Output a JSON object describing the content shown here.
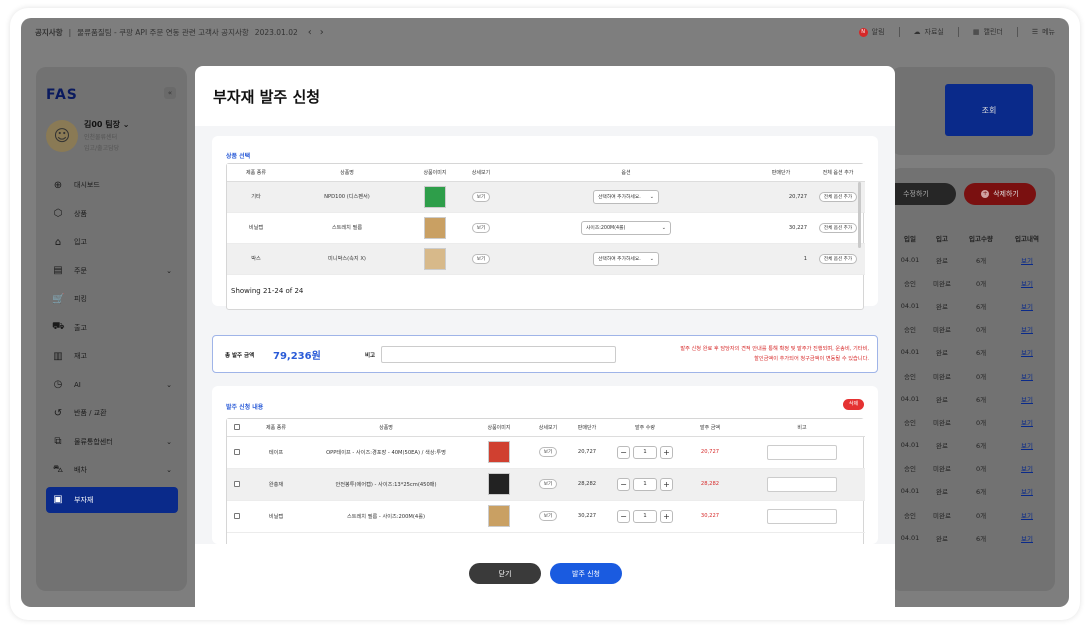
{
  "topbar": {
    "notice_tag": "공지사항",
    "notice_text": "물류품질팀 - 쿠팡 API 주문 연동 관련 고객사 공지사항",
    "notice_date": "2023.01.02",
    "prev_icon": "‹",
    "next_icon": "›",
    "notif_badge": "N",
    "notif_label": "알림",
    "data_label": "자료실",
    "calendar_label": "캘린더",
    "menu_label": "메뉴"
  },
  "sidebar": {
    "logo": "FAS",
    "collapse_icon": "«",
    "user_name": "김00 팀장",
    "user_team": "인천물류센터",
    "user_role": "입고/출고담당",
    "items": [
      {
        "label": "대시보드",
        "icon": "⊕"
      },
      {
        "label": "상품",
        "icon": "⬡"
      },
      {
        "label": "입고",
        "icon": "⌂"
      },
      {
        "label": "주문",
        "icon": "▤",
        "chevron": "⌄"
      },
      {
        "label": "피킹",
        "icon": "🛒"
      },
      {
        "label": "출고",
        "icon": "⛟"
      },
      {
        "label": "재고",
        "icon": "▥"
      },
      {
        "label": "AI",
        "icon": "◷",
        "chevron": "⌄"
      },
      {
        "label": "반품 / 교환",
        "icon": "↺"
      },
      {
        "label": "물류통합센터",
        "icon": "⧉",
        "chevron": "⌄"
      },
      {
        "label": "배차",
        "icon": "⛍",
        "chevron": "⌄"
      },
      {
        "label": "부자재",
        "icon": "▣"
      }
    ]
  },
  "background": {
    "search_button": "조회",
    "edit_button": "수정하기",
    "delete_button": "삭제하기",
    "delete_icon": "+",
    "columns": [
      "입일",
      "입고",
      "입고수량",
      "입고내역"
    ],
    "rows": [
      [
        "04.01",
        "완료",
        "6개",
        "보기"
      ],
      [
        "승인",
        "미완료",
        "0개",
        "보기"
      ],
      [
        "04.01",
        "완료",
        "6개",
        "보기"
      ],
      [
        "승인",
        "미완료",
        "0개",
        "보기"
      ],
      [
        "04.01",
        "완료",
        "6개",
        "보기"
      ],
      [
        "승인",
        "미완료",
        "0개",
        "보기"
      ],
      [
        "04.01",
        "완료",
        "6개",
        "보기"
      ],
      [
        "승인",
        "미완료",
        "0개",
        "보기"
      ],
      [
        "04.01",
        "완료",
        "6개",
        "보기"
      ],
      [
        "승인",
        "미완료",
        "0개",
        "보기"
      ],
      [
        "04.01",
        "완료",
        "6개",
        "보기"
      ],
      [
        "승인",
        "미완료",
        "0개",
        "보기"
      ],
      [
        "04.01",
        "완료",
        "6개",
        "보기"
      ]
    ]
  },
  "modal": {
    "title": "부자재 발주 신청",
    "product_section_title": "상품 선택",
    "product_columns": [
      "제품 종류",
      "상품명",
      "상품이미지",
      "상세보기",
      "옵션",
      "판매단가",
      "전체 옵션 추가"
    ],
    "product_rows": [
      {
        "type": "기타",
        "name": "NPD100 (디스펜서)",
        "detail": "보기",
        "option": "선택하여 추가하세요.",
        "price": "20,727",
        "add": "전체 옵션 추가",
        "thumb_color": "#2e9e4a"
      },
      {
        "type": "비닐랩",
        "name": "스트레치 필름",
        "detail": "보기",
        "option": "사이즈:200M(4롤)",
        "price": "30,227",
        "add": "전체 옵션 추가",
        "thumb_color": "#c9a063"
      },
      {
        "type": "박스",
        "name": "미니박스(속지 X)",
        "detail": "보기",
        "option": "선택하여 추가하세요.",
        "price": "1",
        "add": "전체 옵션 추가",
        "thumb_color": "#d7b98a"
      }
    ],
    "showing": "Showing 21-24 of 24",
    "total_label": "총 발주 금액",
    "total_value": "79,236원",
    "memo_label": "비고",
    "notice_line1": "발주 신청 완료 후 담당자의 견적 안내를 통해 확정 및 발주가 진행되며, 운송비, 기타비,",
    "notice_line2": "할인금액이 추가되어 청구금액이 변동될 수 있습니다.",
    "order_section_title": "발주 신청 내용",
    "delete_label": "삭제",
    "order_columns": [
      "",
      "제품 종류",
      "상품명",
      "상품이미지",
      "상세보기",
      "판매단가",
      "발주 수량",
      "발주 금액",
      "비고"
    ],
    "order_rows": [
      {
        "type": "테이프",
        "name": "OPP테이프 - 사이즈:경포장 - 40M(50EA) / 색상:투명",
        "detail": "보기",
        "price": "20,727",
        "qty": "1",
        "amount": "20,727",
        "thumb_color": "#d04030"
      },
      {
        "type": "완충재",
        "name": "안전봉투(에어캡) - 사이즈:13*25cm(450매)",
        "detail": "보기",
        "price": "28,282",
        "qty": "1",
        "amount": "28,282",
        "thumb_color": "#222222"
      },
      {
        "type": "비닐랩",
        "name": "스트레치 필름 - 사이즈:200M(4롤)",
        "detail": "보기",
        "price": "30,227",
        "qty": "1",
        "amount": "30,227",
        "thumb_color": "#c9a063"
      }
    ],
    "minus": "−",
    "plus": "+",
    "close_button": "닫기",
    "submit_button": "발주 신청"
  }
}
